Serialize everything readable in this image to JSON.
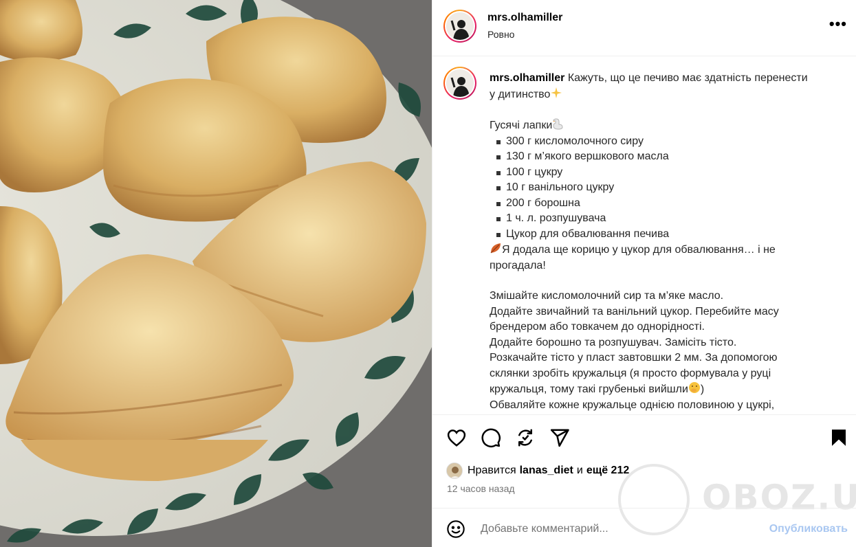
{
  "post": {
    "username": "mrs.olhamiller",
    "location": "Ровно",
    "more_label": "•••"
  },
  "caption": {
    "username": "mrs.olhamiller",
    "intro_1": "Кажуть, що це печиво має здатність перенести",
    "intro_2": "у дитинство",
    "title": "Гусячі лапки",
    "ingredients": [
      "300 г кисломолочного сиру",
      "130 г м’якого вершкового масла",
      "100 г цукру",
      "10 г ванільного цукру",
      "200 г борошна",
      "1 ч. л. розпушувача",
      "Цукор для обвалювання печива"
    ],
    "note_1": "Я додала ще корицю у цукор для обвалювання… і не",
    "note_2": "прогадала!",
    "steps": [
      "Змішайте кисломолочний сир та м’яке масло.",
      "Додайте звичайний та ванільний цукор. Перебийте масу",
      "брендером або товкачем до однорідності.",
      "Додайте борошно та розпушувач. Замісіть тісто.",
      "Розкачайте тісто у пласт завтовшки 2 мм. За допомогою",
      "склянки зробіть кружальця (я просто формувала у руці",
      "кружальця, тому такі грубенькі вийшли",
      "Обваляйте кожне кружальце однією половиною у цукрі,"
    ],
    "step_7_tail": ")"
  },
  "actions": {
    "like_icon": "heart-icon",
    "comment_icon": "comment-icon",
    "share_icon": "repost-icon",
    "send_icon": "send-icon",
    "save_icon": "bookmark-icon"
  },
  "likes": {
    "prefix": "Нравится",
    "user": "lanas_diet",
    "middle": "и",
    "others": "ещё 212"
  },
  "timestamp": "12 часов назад",
  "comment": {
    "placeholder": "Добавьте комментарий...",
    "publish_label": "Опубликовать"
  },
  "watermark": "OBOZ.UA",
  "colors": {
    "publish": "#a9c7f1",
    "text_secondary": "#737373",
    "border": "#efefef"
  }
}
